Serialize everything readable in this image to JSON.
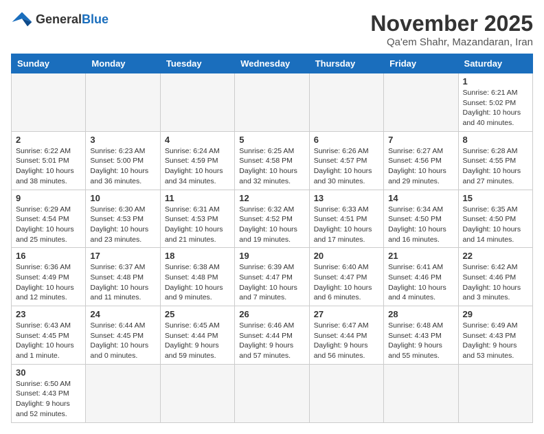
{
  "header": {
    "logo_general": "General",
    "logo_blue": "Blue",
    "title": "November 2025",
    "location": "Qa'em Shahr, Mazandaran, Iran"
  },
  "weekdays": [
    "Sunday",
    "Monday",
    "Tuesday",
    "Wednesday",
    "Thursday",
    "Friday",
    "Saturday"
  ],
  "days": [
    {
      "num": "",
      "empty": true
    },
    {
      "num": "",
      "empty": true
    },
    {
      "num": "",
      "empty": true
    },
    {
      "num": "",
      "empty": true
    },
    {
      "num": "",
      "empty": true
    },
    {
      "num": "",
      "empty": true
    },
    {
      "num": "1",
      "sunrise": "6:21 AM",
      "sunset": "5:02 PM",
      "daylight": "10 hours and 40 minutes."
    }
  ],
  "week2": [
    {
      "num": "2",
      "sunrise": "6:22 AM",
      "sunset": "5:01 PM",
      "daylight": "10 hours and 38 minutes."
    },
    {
      "num": "3",
      "sunrise": "6:23 AM",
      "sunset": "5:00 PM",
      "daylight": "10 hours and 36 minutes."
    },
    {
      "num": "4",
      "sunrise": "6:24 AM",
      "sunset": "4:59 PM",
      "daylight": "10 hours and 34 minutes."
    },
    {
      "num": "5",
      "sunrise": "6:25 AM",
      "sunset": "4:58 PM",
      "daylight": "10 hours and 32 minutes."
    },
    {
      "num": "6",
      "sunrise": "6:26 AM",
      "sunset": "4:57 PM",
      "daylight": "10 hours and 30 minutes."
    },
    {
      "num": "7",
      "sunrise": "6:27 AM",
      "sunset": "4:56 PM",
      "daylight": "10 hours and 29 minutes."
    },
    {
      "num": "8",
      "sunrise": "6:28 AM",
      "sunset": "4:55 PM",
      "daylight": "10 hours and 27 minutes."
    }
  ],
  "week3": [
    {
      "num": "9",
      "sunrise": "6:29 AM",
      "sunset": "4:54 PM",
      "daylight": "10 hours and 25 minutes."
    },
    {
      "num": "10",
      "sunrise": "6:30 AM",
      "sunset": "4:53 PM",
      "daylight": "10 hours and 23 minutes."
    },
    {
      "num": "11",
      "sunrise": "6:31 AM",
      "sunset": "4:53 PM",
      "daylight": "10 hours and 21 minutes."
    },
    {
      "num": "12",
      "sunrise": "6:32 AM",
      "sunset": "4:52 PM",
      "daylight": "10 hours and 19 minutes."
    },
    {
      "num": "13",
      "sunrise": "6:33 AM",
      "sunset": "4:51 PM",
      "daylight": "10 hours and 17 minutes."
    },
    {
      "num": "14",
      "sunrise": "6:34 AM",
      "sunset": "4:50 PM",
      "daylight": "10 hours and 16 minutes."
    },
    {
      "num": "15",
      "sunrise": "6:35 AM",
      "sunset": "4:50 PM",
      "daylight": "10 hours and 14 minutes."
    }
  ],
  "week4": [
    {
      "num": "16",
      "sunrise": "6:36 AM",
      "sunset": "4:49 PM",
      "daylight": "10 hours and 12 minutes."
    },
    {
      "num": "17",
      "sunrise": "6:37 AM",
      "sunset": "4:48 PM",
      "daylight": "10 hours and 11 minutes."
    },
    {
      "num": "18",
      "sunrise": "6:38 AM",
      "sunset": "4:48 PM",
      "daylight": "10 hours and 9 minutes."
    },
    {
      "num": "19",
      "sunrise": "6:39 AM",
      "sunset": "4:47 PM",
      "daylight": "10 hours and 7 minutes."
    },
    {
      "num": "20",
      "sunrise": "6:40 AM",
      "sunset": "4:47 PM",
      "daylight": "10 hours and 6 minutes."
    },
    {
      "num": "21",
      "sunrise": "6:41 AM",
      "sunset": "4:46 PM",
      "daylight": "10 hours and 4 minutes."
    },
    {
      "num": "22",
      "sunrise": "6:42 AM",
      "sunset": "4:46 PM",
      "daylight": "10 hours and 3 minutes."
    }
  ],
  "week5": [
    {
      "num": "23",
      "sunrise": "6:43 AM",
      "sunset": "4:45 PM",
      "daylight": "10 hours and 1 minute."
    },
    {
      "num": "24",
      "sunrise": "6:44 AM",
      "sunset": "4:45 PM",
      "daylight": "10 hours and 0 minutes."
    },
    {
      "num": "25",
      "sunrise": "6:45 AM",
      "sunset": "4:44 PM",
      "daylight": "9 hours and 59 minutes."
    },
    {
      "num": "26",
      "sunrise": "6:46 AM",
      "sunset": "4:44 PM",
      "daylight": "9 hours and 57 minutes."
    },
    {
      "num": "27",
      "sunrise": "6:47 AM",
      "sunset": "4:44 PM",
      "daylight": "9 hours and 56 minutes."
    },
    {
      "num": "28",
      "sunrise": "6:48 AM",
      "sunset": "4:43 PM",
      "daylight": "9 hours and 55 minutes."
    },
    {
      "num": "29",
      "sunrise": "6:49 AM",
      "sunset": "4:43 PM",
      "daylight": "9 hours and 53 minutes."
    }
  ],
  "week6": [
    {
      "num": "30",
      "sunrise": "6:50 AM",
      "sunset": "4:43 PM",
      "daylight": "9 hours and 52 minutes."
    },
    {
      "num": "",
      "empty": true
    },
    {
      "num": "",
      "empty": true
    },
    {
      "num": "",
      "empty": true
    },
    {
      "num": "",
      "empty": true
    },
    {
      "num": "",
      "empty": true
    },
    {
      "num": "",
      "empty": true
    }
  ]
}
